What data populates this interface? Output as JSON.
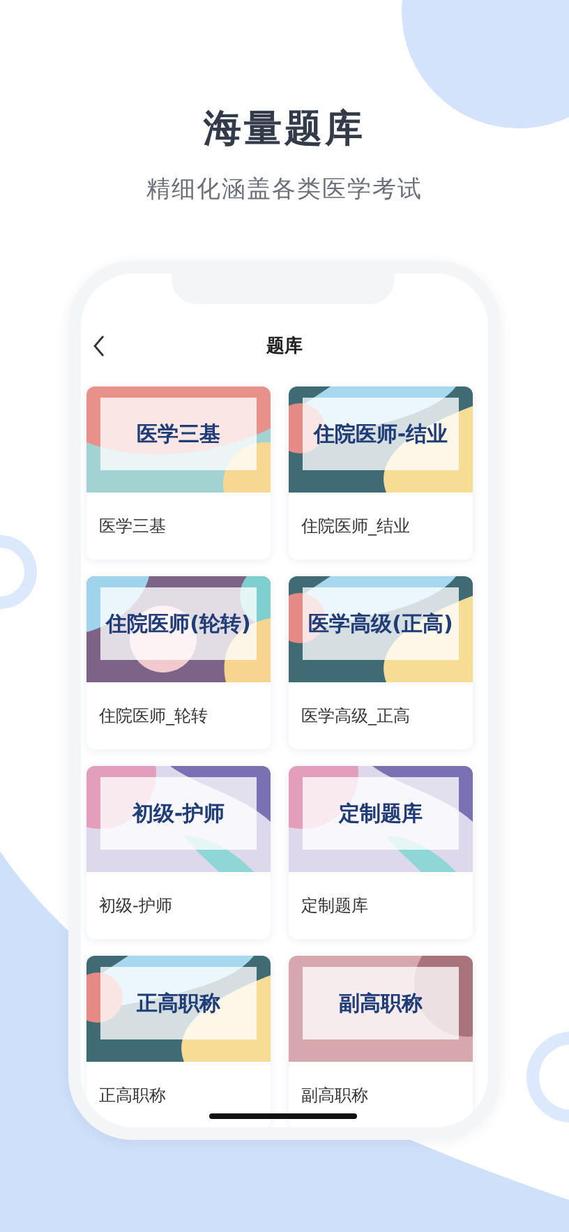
{
  "headline": "海量题库",
  "subtitle": "精细化涵盖各类医学考试",
  "screen": {
    "title": "题库",
    "cards": [
      {
        "kind": "coral",
        "cover_title": "医学三基",
        "label": "医学三基"
      },
      {
        "kind": "teal",
        "cover_title": "住院医师-结业",
        "label": "住院医师_结业"
      },
      {
        "kind": "plum",
        "cover_title": "住院医师(轮转)",
        "label": "住院医师_轮转"
      },
      {
        "kind": "teal",
        "cover_title": "医学高级(正高)",
        "label": "医学高级_正高"
      },
      {
        "kind": "lavender",
        "cover_title": "初级-护师",
        "label": "初级-护师"
      },
      {
        "kind": "lavender",
        "cover_title": "定制题库",
        "label": "定制题库"
      },
      {
        "kind": "teal",
        "cover_title": "正高职称",
        "label": "正高职称"
      },
      {
        "kind": "rose",
        "cover_title": "副高职称",
        "label": "副高职称"
      }
    ]
  }
}
